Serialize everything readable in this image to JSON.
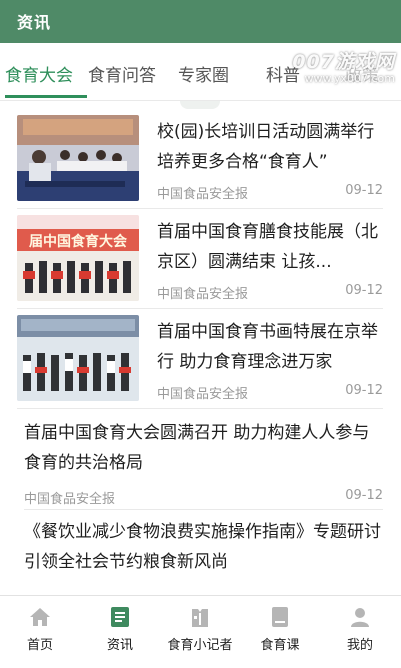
{
  "header": {
    "title": "资讯"
  },
  "watermark": {
    "line1": "007游戏网",
    "line2": "www.yx007.com"
  },
  "tabs": [
    {
      "label": "食育大会",
      "active": true
    },
    {
      "label": "食育问答",
      "active": false
    },
    {
      "label": "专家圈",
      "active": false
    },
    {
      "label": "科普",
      "active": false
    },
    {
      "label": "政策",
      "active": false
    }
  ],
  "articles": [
    {
      "title": "校(园)长培训日活动圆满举行 培养更多合格“食育人”",
      "source": "中国食品安全报",
      "date": "09-12",
      "thumb_banner": ""
    },
    {
      "title": "首届中国食育膳食技能展（北京区）圆满结束 让孩...",
      "source": "中国食品安全报",
      "date": "09-12",
      "thumb_banner": "届中国食育大会"
    },
    {
      "title": "首届中国食育书画特展在京举行 助力食育理念进万家",
      "source": "中国食品安全报",
      "date": "09-12",
      "thumb_banner": ""
    },
    {
      "title": "首届中国食育大会圆满召开 助力构建人人参与食育的共治格局",
      "source": "中国食品安全报",
      "date": "09-12"
    },
    {
      "title": "《餐饮业减少食物浪费实施操作指南》专题研讨 引领全社会节约粮食新风尚"
    }
  ],
  "bottom_nav": [
    {
      "label": "首页",
      "icon": "home-icon",
      "active": false
    },
    {
      "label": "资讯",
      "icon": "news-icon",
      "active": true
    },
    {
      "label": "食育小记者",
      "icon": "reporter-icon",
      "active": false
    },
    {
      "label": "食育课",
      "icon": "course-icon",
      "active": false
    },
    {
      "label": "我的",
      "icon": "profile-icon",
      "active": false
    }
  ],
  "colors": {
    "brand": "#4f8a67",
    "accent": "#2f8f5b",
    "nav_inactive": "#b5b5b5"
  }
}
